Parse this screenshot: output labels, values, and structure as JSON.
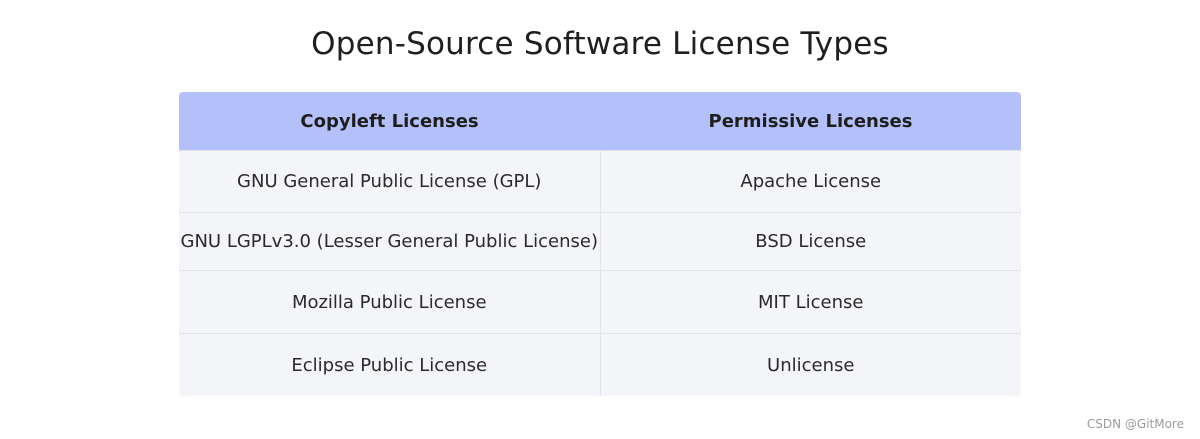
{
  "title": "Open-Source Software License Types",
  "table": {
    "headers": [
      "Copyleft Licenses",
      "Permissive Licenses"
    ],
    "rows": [
      [
        "GNU General Public License (GPL)",
        "Apache License"
      ],
      [
        "GNU LGPLv3.0 (Lesser General Public License)",
        "BSD License"
      ],
      [
        "Mozilla Public License",
        "MIT License"
      ],
      [
        "Eclipse Public License",
        "Unlicense"
      ]
    ]
  },
  "watermark": "CSDN @GitMore",
  "colors": {
    "header_background": "#b4c0fa",
    "row_background": "#f4f5f8"
  }
}
